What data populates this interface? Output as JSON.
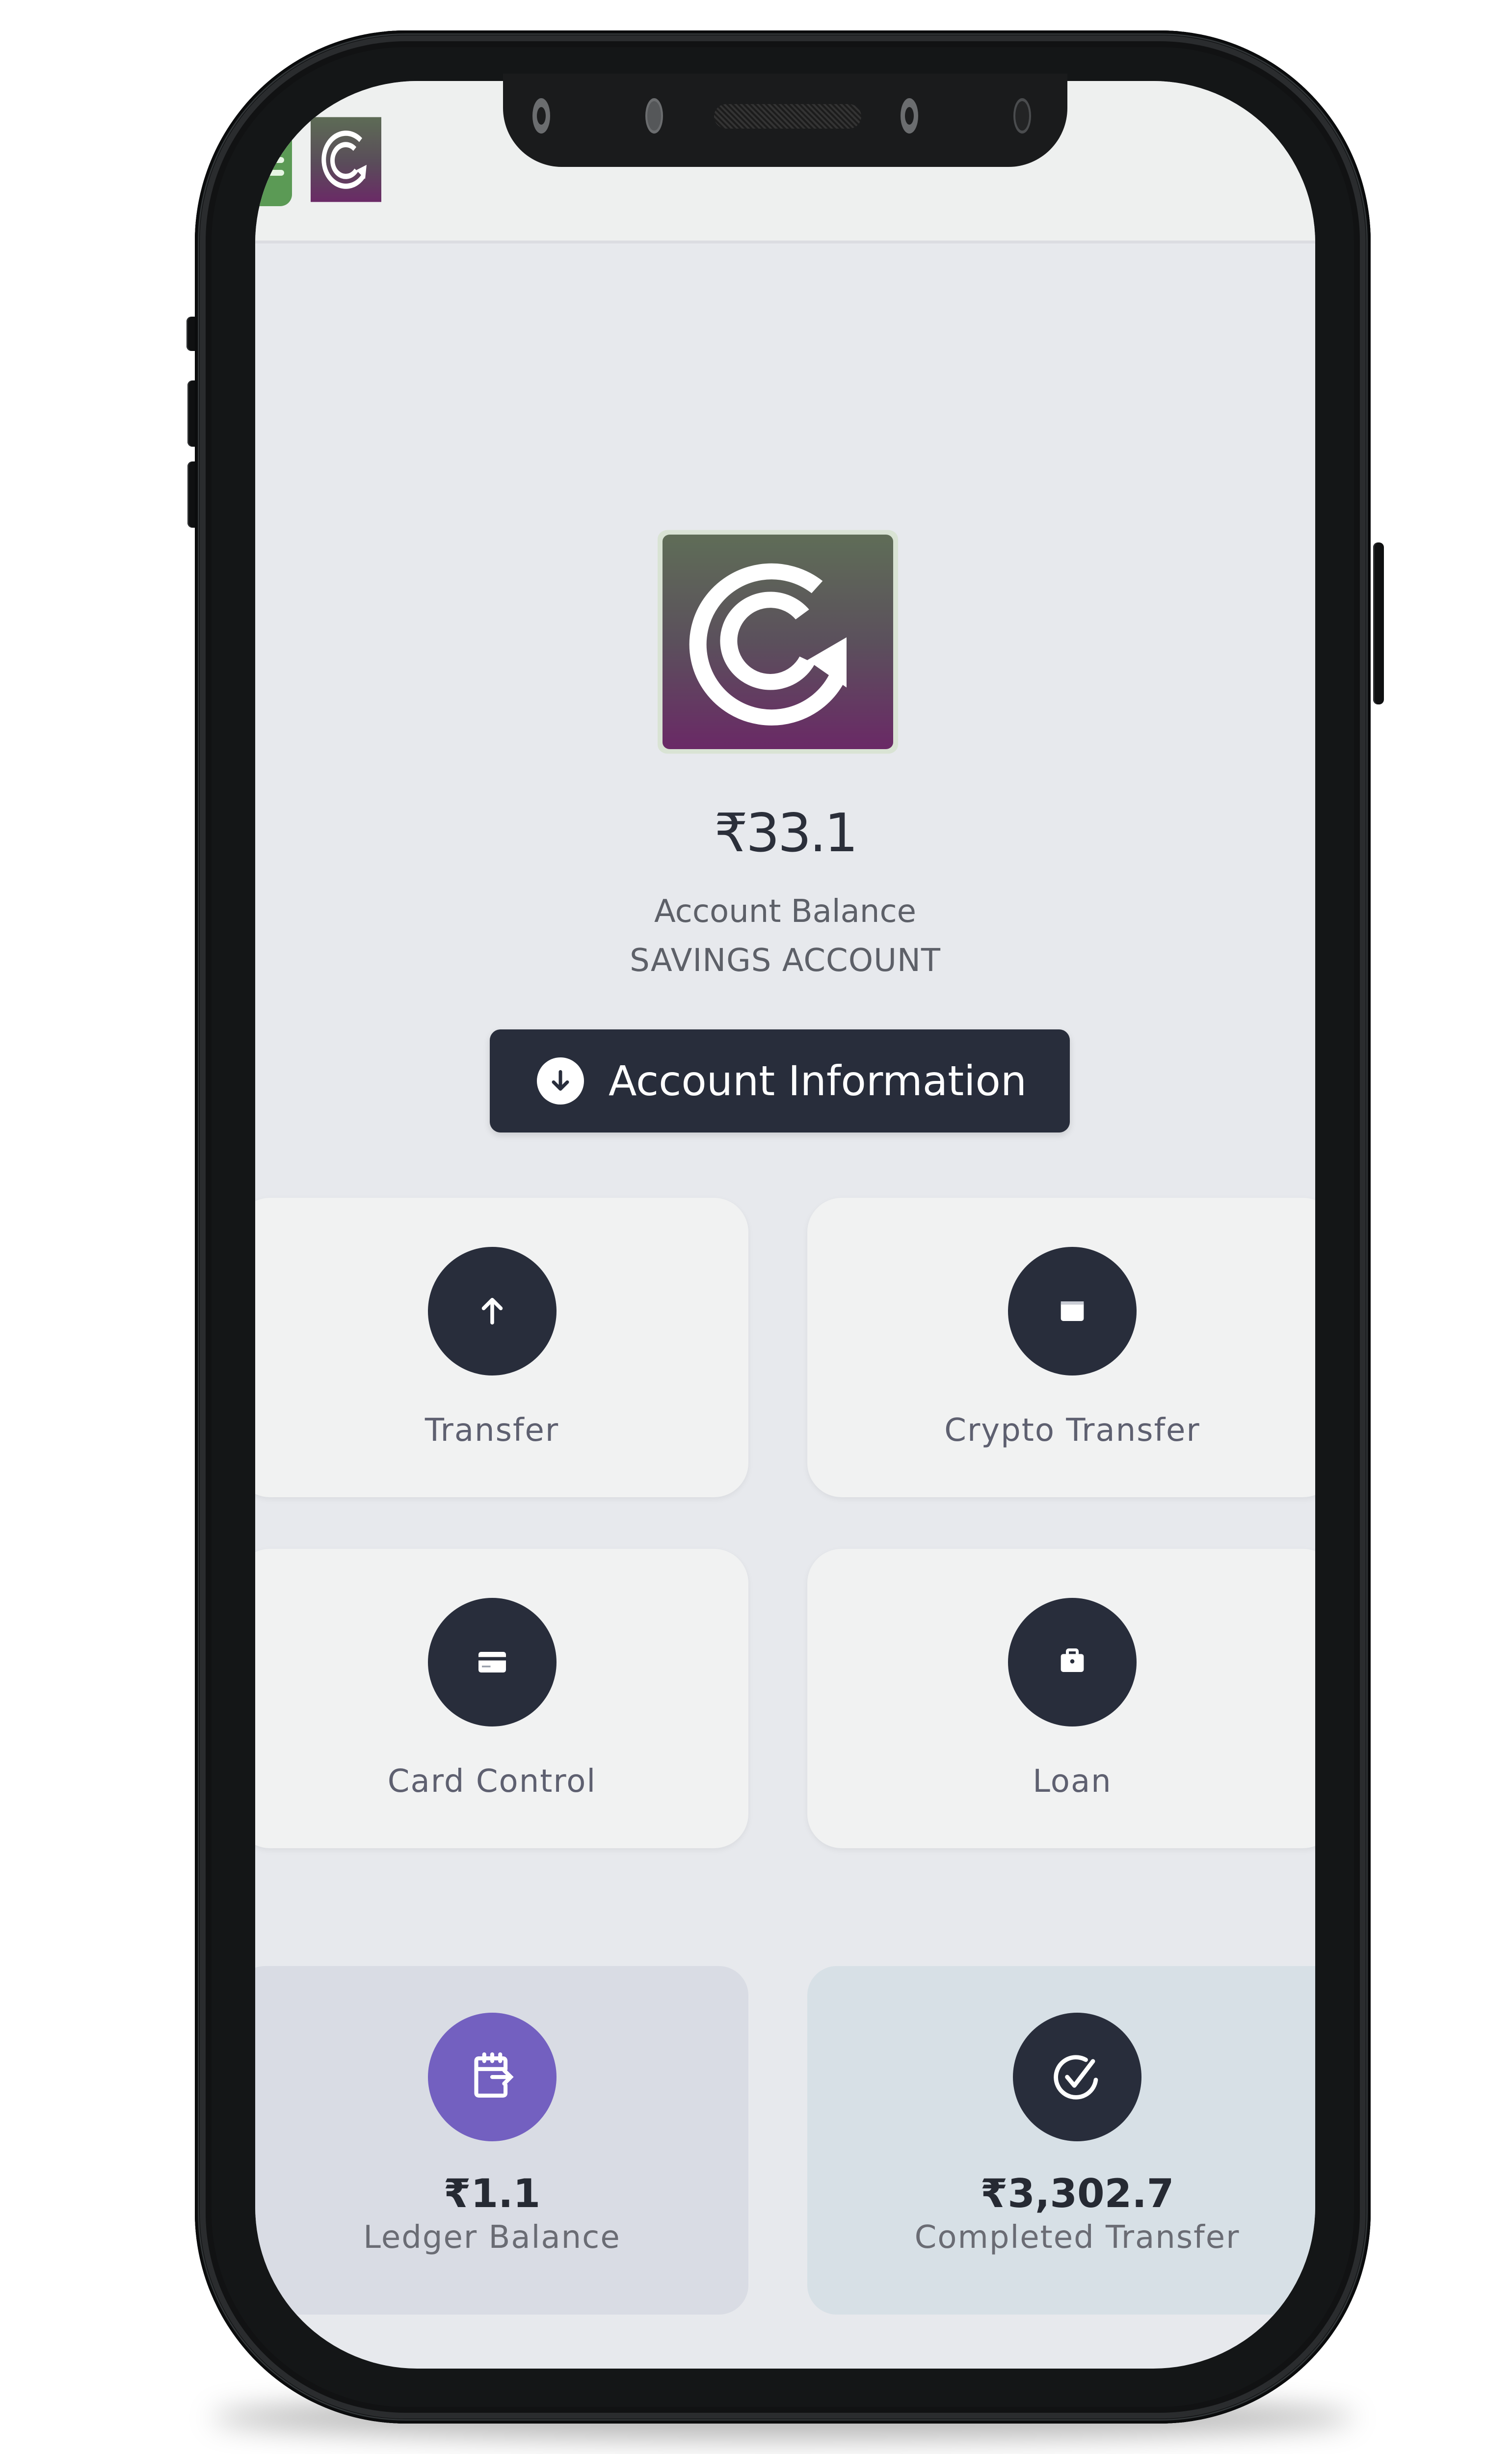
{
  "app": {
    "menu_icon": "hamburger-icon",
    "logo_icon": "brand-logo-c-arrow",
    "colors": {
      "menu_button": "#5b9a55",
      "logo_top": "#5d6b55",
      "logo_bottom": "#6a2a66",
      "dark_accent": "#282d3b",
      "ledger_accent": "#7360c0"
    }
  },
  "account": {
    "balance": "₹33.1",
    "balance_label": "Account Balance",
    "account_type": "SAVINGS ACCOUNT",
    "info_button": {
      "label": "Account Information",
      "icon": "download-circle-icon"
    }
  },
  "actions": [
    {
      "label": "Transfer",
      "icon": "arrow-up-icon"
    },
    {
      "label": "Crypto Transfer",
      "icon": "wallet-icon"
    },
    {
      "label": "Card Control",
      "icon": "credit-card-icon"
    },
    {
      "label": "Loan",
      "icon": "briefcase-icon"
    }
  ],
  "stats": [
    {
      "value": "₹1.1",
      "label": "Ledger Balance",
      "icon": "calendar-arrow-icon"
    },
    {
      "value": "₹3,302.7",
      "label": "Completed Transfer",
      "icon": "check-circle-icon"
    }
  ]
}
